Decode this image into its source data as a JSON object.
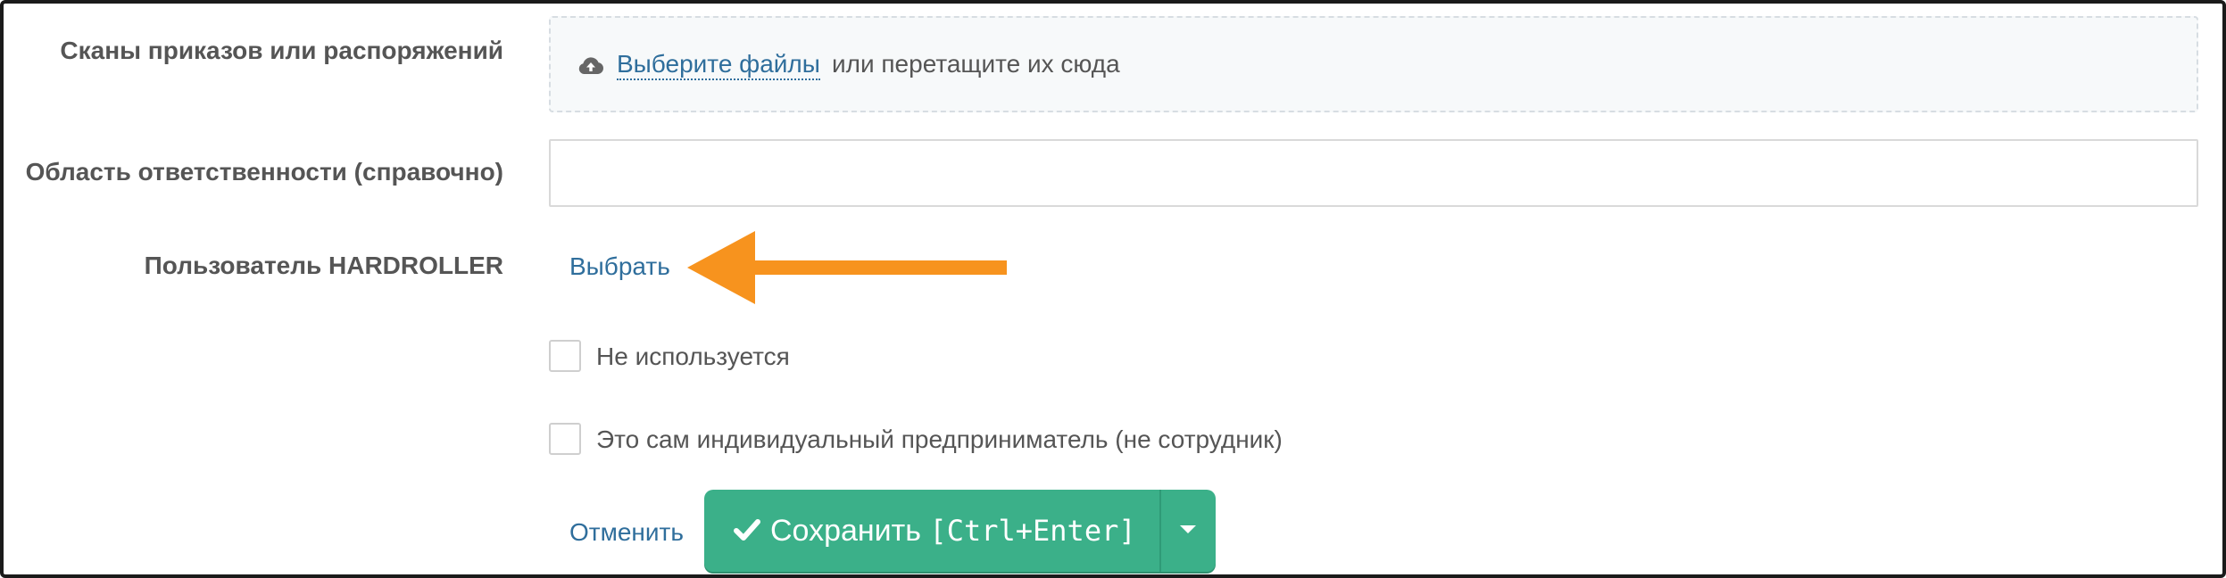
{
  "form": {
    "scans": {
      "label": "Сканы приказов или распоряжений",
      "choose_link": "Выберите файлы",
      "drag_text": "или перетащите их сюда",
      "icon": "cloud-upload-icon"
    },
    "responsibility": {
      "label": "Область ответственности (справочно)",
      "value": "",
      "placeholder": ""
    },
    "user": {
      "label": "Пользователь HARDROLLER",
      "select_link": "Выбрать",
      "annotation_color": "#f7931e"
    },
    "checkboxes": [
      {
        "label": "Не используется",
        "checked": false
      },
      {
        "label": "Это сам индивидуальный предприниматель (не сотрудник)",
        "checked": false
      }
    ],
    "actions": {
      "cancel_label": "Отменить",
      "save_label": "Сохранить",
      "save_shortcut": "[Ctrl+Enter]",
      "save_icon": "checkmark-icon",
      "dropdown_icon": "caret-down-icon",
      "save_color": "#3bb089"
    }
  },
  "colors": {
    "link": "#2f6e9c",
    "label": "#555555",
    "accent_arrow": "#f7931e"
  }
}
